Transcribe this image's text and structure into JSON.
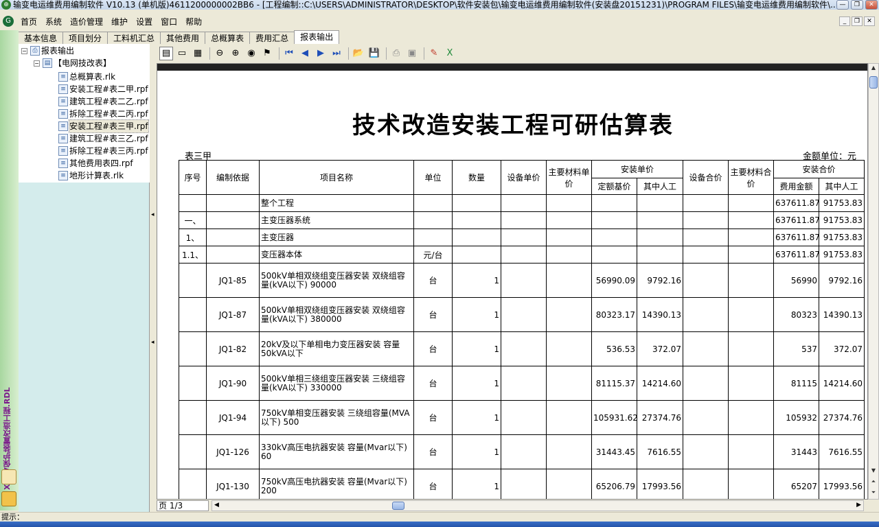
{
  "window": {
    "title": "输变电运维费用编制软件 V10.13 (单机版)4611200000002BB6 - [工程编制::C:\\USERS\\ADMINISTRATOR\\DESKTOP\\软件安装包\\输变电运维费用编制软件(安装盘20151231)\\PROGRAM FILES\\输变电运维费用编制软件\\..."
  },
  "menu": [
    "首页",
    "系统",
    "造价管理",
    "维护",
    "设置",
    "窗口",
    "帮助"
  ],
  "tabs": [
    "基本信息",
    "项目划分",
    "工料机汇总",
    "其他费用",
    "总概算表",
    "费用汇总",
    "报表输出"
  ],
  "active_tab": "报表输出",
  "side_strip_text": "XXkV保护装置改造工程.RDL",
  "tree": {
    "root": "报表输出",
    "group": "【电网技改表】",
    "items": [
      "总概算表.rlk",
      "安装工程#表二甲.rpf",
      "建筑工程#表二乙.rpf",
      "拆除工程#表二丙.rpf",
      "安装工程#表三甲.rpf",
      "建筑工程#表三乙.rpf",
      "拆除工程#表三丙.rpf",
      "其他费用表四.rpf",
      "地形计算表.rlk"
    ],
    "selected": "安装工程#表三甲.rpf"
  },
  "toolbar_icons": [
    "page-layout-icon",
    "single-page-icon",
    "multi-page-icon",
    "zoom-out-icon",
    "zoom-in-icon",
    "zoom-select-icon",
    "find-icon",
    "first-page-icon",
    "prev-page-icon",
    "next-page-icon",
    "last-page-icon",
    "open-icon",
    "save-icon",
    "print-icon",
    "print-setup-icon",
    "chart-icon",
    "excel-export-icon"
  ],
  "report": {
    "title": "技术改造安装工程可研估算表",
    "table_code": "表三甲",
    "unit": "金额单位：元",
    "headers": {
      "seq": "序号",
      "basis": "编制依据",
      "name": "项目名称",
      "unit": "单位",
      "qty": "数量",
      "equip_price": "设备单价",
      "main_mat_price": "主要材料单价",
      "install_unit": "安装单价",
      "quota_base": "定额基价",
      "labor": "其中人工",
      "equip_total": "设备合价",
      "main_mat_total": "主要材料合价",
      "install_total": "安装合价",
      "fee": "费用金额",
      "labor_total": "其中人工"
    },
    "rows": [
      {
        "seq": "",
        "basis": "",
        "name": "整个工程",
        "unit": "",
        "qty": "",
        "quota": "",
        "labor": "",
        "fee": "637611.87",
        "labor_total": "91753.83"
      },
      {
        "seq": "一、",
        "basis": "",
        "name": "主变压器系统",
        "unit": "",
        "qty": "",
        "quota": "",
        "labor": "",
        "fee": "637611.87",
        "labor_total": "91753.83"
      },
      {
        "seq": "1、",
        "basis": "",
        "name": "主变压器",
        "unit": "",
        "qty": "",
        "quota": "",
        "labor": "",
        "fee": "637611.87",
        "labor_total": "91753.83"
      },
      {
        "seq": "1.1、",
        "basis": "",
        "name": "变压器本体",
        "unit": "元/台",
        "qty": "",
        "quota": "",
        "labor": "",
        "fee": "637611.87",
        "labor_total": "91753.83"
      },
      {
        "seq": "",
        "basis": "JQ1-85",
        "name": "500kV单相双绕组变压器安装 双绕组容量(kVA以下) 90000",
        "unit": "台",
        "qty": "1",
        "quota": "56990.09",
        "labor": "9792.16",
        "fee": "56990",
        "labor_total": "9792.16"
      },
      {
        "seq": "",
        "basis": "JQ1-87",
        "name": "500kV单相双绕组变压器安装 双绕组容量(kVA以下) 380000",
        "unit": "台",
        "qty": "1",
        "quota": "80323.17",
        "labor": "14390.13",
        "fee": "80323",
        "labor_total": "14390.13"
      },
      {
        "seq": "",
        "basis": "JQ1-82",
        "name": "20kV及以下单相电力变压器安装 容量50kVA以下",
        "unit": "台",
        "qty": "1",
        "quota": "536.53",
        "labor": "372.07",
        "fee": "537",
        "labor_total": "372.07"
      },
      {
        "seq": "",
        "basis": "JQ1-90",
        "name": "500kV单相三绕组变压器安装 三绕组容量(kVA以下) 330000",
        "unit": "台",
        "qty": "1",
        "quota": "81115.37",
        "labor": "14214.60",
        "fee": "81115",
        "labor_total": "14214.60"
      },
      {
        "seq": "",
        "basis": "JQ1-94",
        "name": "750kV单相变压器安装 三绕组容量(MVA以下) 500",
        "unit": "台",
        "qty": "1",
        "quota": "105931.62",
        "labor": "27374.76",
        "fee": "105932",
        "labor_total": "27374.76"
      },
      {
        "seq": "",
        "basis": "JQ1-126",
        "name": "330kV高压电抗器安装 容量(Mvar以下) 60",
        "unit": "台",
        "qty": "1",
        "quota": "31443.45",
        "labor": "7616.55",
        "fee": "31443",
        "labor_total": "7616.55"
      },
      {
        "seq": "",
        "basis": "JQ1-130",
        "name": "750kV高压电抗器安装 容量(Mvar以下) 200",
        "unit": "台",
        "qty": "1",
        "quota": "65206.79",
        "labor": "17993.56",
        "fee": "65207",
        "labor_total": "17993.56"
      }
    ]
  },
  "page_indicator": "页 1/3",
  "status": "提示："
}
